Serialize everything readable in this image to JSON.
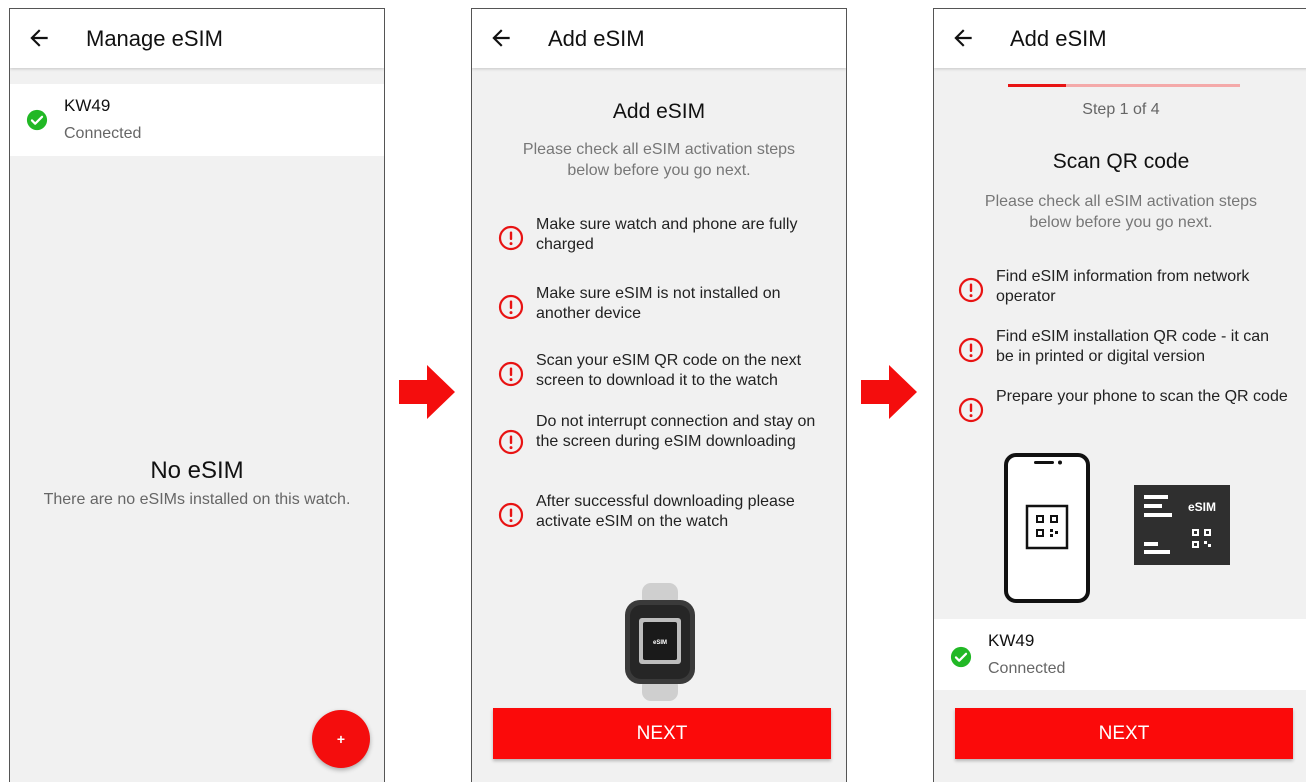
{
  "screen1": {
    "title": "Manage eSIM",
    "device": {
      "name": "KW49",
      "status": "Connected"
    },
    "empty_title": "No eSIM",
    "empty_subtitle": "There are no eSIMs installed on this watch.",
    "fab_label": "+"
  },
  "screen2": {
    "title": "Add eSIM",
    "heading": "Add eSIM",
    "description": "Please check all eSIM activation steps below before you go next.",
    "steps": [
      "Make sure watch and phone are fully charged",
      "Make sure eSIM is not installed on another device",
      "Scan your eSIM QR code on the next screen to download it to the watch",
      "Do not interrupt connection and stay on the screen during eSIM downloading",
      "After successful downloading please activate eSIM on the watch"
    ],
    "watch_chip_label": "eSIM",
    "next_label": "NEXT"
  },
  "screen3": {
    "title": "Add eSIM",
    "progress": 0.25,
    "step_indicator": "Step 1 of 4",
    "heading": "Scan QR code",
    "description": "Please check all eSIM activation steps below before you go next.",
    "steps": [
      "Find eSIM information from network operator",
      "Find eSIM installation QR code - it can be in printed or digital version",
      "Prepare your phone to scan the QR code"
    ],
    "card_label": "eSIM",
    "device": {
      "name": "KW49",
      "status": "Connected"
    },
    "next_label": "NEXT"
  },
  "colors": {
    "accent": "#fb0a0a",
    "success": "#21b825",
    "warning": "#e81313",
    "progress_track": "#f4a9a9"
  },
  "icons": {
    "back": "arrow-left-icon",
    "connected": "check-circle-icon",
    "warning": "exclamation-circle-icon",
    "flow": "arrow-right-icon"
  }
}
